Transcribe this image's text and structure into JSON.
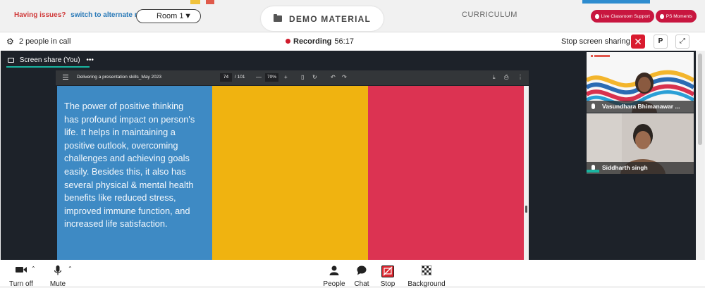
{
  "topbar": {
    "issues_text": "Having issues?",
    "switch_text": "switch to alternate room",
    "room_label": "Room 1",
    "demo_tab": "DEMO MATERIAL",
    "curriculum_tab": "CURRICULUM",
    "live_support": "Live Classroom Support",
    "ps_moments": "PS Moments"
  },
  "call": {
    "people_count": "2 people in call",
    "recording_label": "Recording",
    "recording_time": "56:17",
    "stop_share": "Stop screen sharing",
    "close_symbol": "✕",
    "p_button": "P",
    "fullscreen_symbol": "⤢"
  },
  "screenshare": {
    "label": "Screen share (You)",
    "more": "•••"
  },
  "pdf": {
    "title": "Delivering a presentation skills_May 2023",
    "page": "74",
    "total": "/ 101",
    "zoom": "70%",
    "minus": "—",
    "plus": "+"
  },
  "slide": {
    "text": "The power of positive thinking\nhas profound impact on person's\nlife. It helps in maintaining a\npositive outlook, overcoming\nchallenges and achieving goals\neasily. Besides this, it also has\nseveral physical & mental health\nbenefits like reduced stress,\nimproved immune function, and\nincreased life satisfaction.",
    "colors": [
      "#3e8ac4",
      "#f0b310",
      "#dc3352"
    ]
  },
  "participants": [
    {
      "name": "Vasundhara Bhimanawar ..."
    },
    {
      "name": "Siddharth singh"
    }
  ],
  "bottom": {
    "turn_off": "Turn off",
    "mute": "Mute",
    "people": "People",
    "chat": "Chat",
    "stop": "Stop",
    "background": "Background"
  },
  "colors": {
    "accent_red": "#c8163f",
    "accent_teal": "#19b5a1",
    "accent_blue": "#2e8ccf"
  }
}
